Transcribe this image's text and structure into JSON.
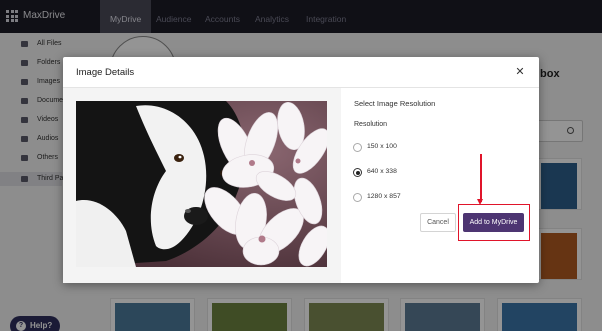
{
  "app": {
    "name": "MaxDrive"
  },
  "tabs": [
    {
      "label": "MyDrive",
      "active": true
    },
    {
      "label": "Audience",
      "active": false
    },
    {
      "label": "Accounts",
      "active": false
    },
    {
      "label": "Analytics",
      "active": false
    },
    {
      "label": "Integration",
      "active": false
    }
  ],
  "sidebar": {
    "items": [
      {
        "label": "All Files",
        "icon": "grid-icon"
      },
      {
        "label": "Folders",
        "icon": "folder-icon"
      },
      {
        "label": "Images",
        "icon": "image-icon"
      },
      {
        "label": "Documents",
        "icon": "document-icon"
      },
      {
        "label": "Videos",
        "icon": "video-icon"
      },
      {
        "label": "Audios",
        "icon": "music-icon"
      },
      {
        "label": "Others",
        "icon": "list-icon"
      },
      {
        "label": "Third Party",
        "icon": "cloud-icon",
        "selected": true
      }
    ]
  },
  "background": {
    "partial_text": "box"
  },
  "help": {
    "label": "Help?"
  },
  "modal": {
    "title": "Image Details",
    "close_glyph": "✕",
    "resolution_title": "Select Image Resolution",
    "resolution_label": "Resolution",
    "options": [
      {
        "label": "150 x 100",
        "selected": false
      },
      {
        "label": "640 x 338",
        "selected": true
      },
      {
        "label": "1280 x 857",
        "selected": false
      }
    ],
    "cancel_label": "Cancel",
    "add_label": "Add to MyDrive"
  },
  "colors": {
    "topbar": "#1d1d27",
    "primary_button": "#4d3572",
    "annotation": "#e0142a"
  }
}
